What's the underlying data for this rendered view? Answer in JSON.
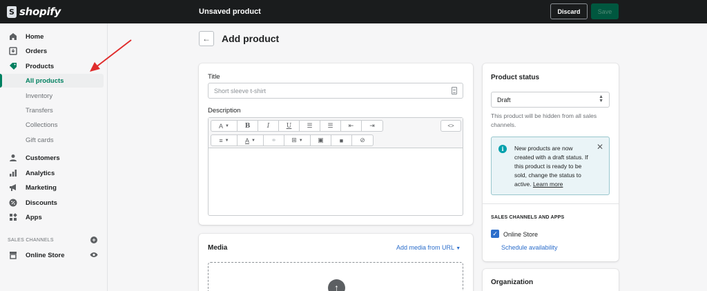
{
  "app": {
    "name": "shopify",
    "brand_color": "#008060"
  },
  "topbar": {
    "title": "Unsaved product",
    "discard_label": "Discard",
    "save_label": "Save"
  },
  "sidebar": {
    "items": [
      {
        "label": "Home",
        "icon": "home-icon"
      },
      {
        "label": "Orders",
        "icon": "orders-icon"
      },
      {
        "label": "Products",
        "icon": "tag-icon"
      }
    ],
    "subitems": [
      {
        "label": "All products",
        "active": true
      },
      {
        "label": "Inventory"
      },
      {
        "label": "Transfers"
      },
      {
        "label": "Collections"
      },
      {
        "label": "Gift cards"
      }
    ],
    "items2": [
      {
        "label": "Customers",
        "icon": "person-icon"
      },
      {
        "label": "Analytics",
        "icon": "bar-chart-icon"
      },
      {
        "label": "Marketing",
        "icon": "megaphone-icon"
      },
      {
        "label": "Discounts",
        "icon": "discount-icon"
      },
      {
        "label": "Apps",
        "icon": "apps-icon"
      }
    ],
    "sales_channels_label": "SALES CHANNELS",
    "online_store_label": "Online Store"
  },
  "page": {
    "title": "Add product"
  },
  "product_form": {
    "title_label": "Title",
    "title_placeholder": "Short sleeve t-shirt",
    "title_value": "",
    "description_label": "Description",
    "toolbar": {
      "font": "A",
      "bold": "B",
      "italic": "I",
      "underline": "U",
      "text_color": "A",
      "html": "<>"
    }
  },
  "media": {
    "title": "Media",
    "add_from_url": "Add media from URL"
  },
  "status": {
    "title": "Product status",
    "selected": "Draft",
    "help": "This product will be hidden from all sales channels.",
    "banner_text": "New products are now created with a draft status. If this product is ready to be sold, change the status to active. ",
    "banner_link": "Learn more",
    "sales_channels_heading": "SALES CHANNELS AND APPS",
    "online_store": "Online Store",
    "online_store_checked": true,
    "schedule": "Schedule availability"
  },
  "organization": {
    "title": "Organization"
  }
}
